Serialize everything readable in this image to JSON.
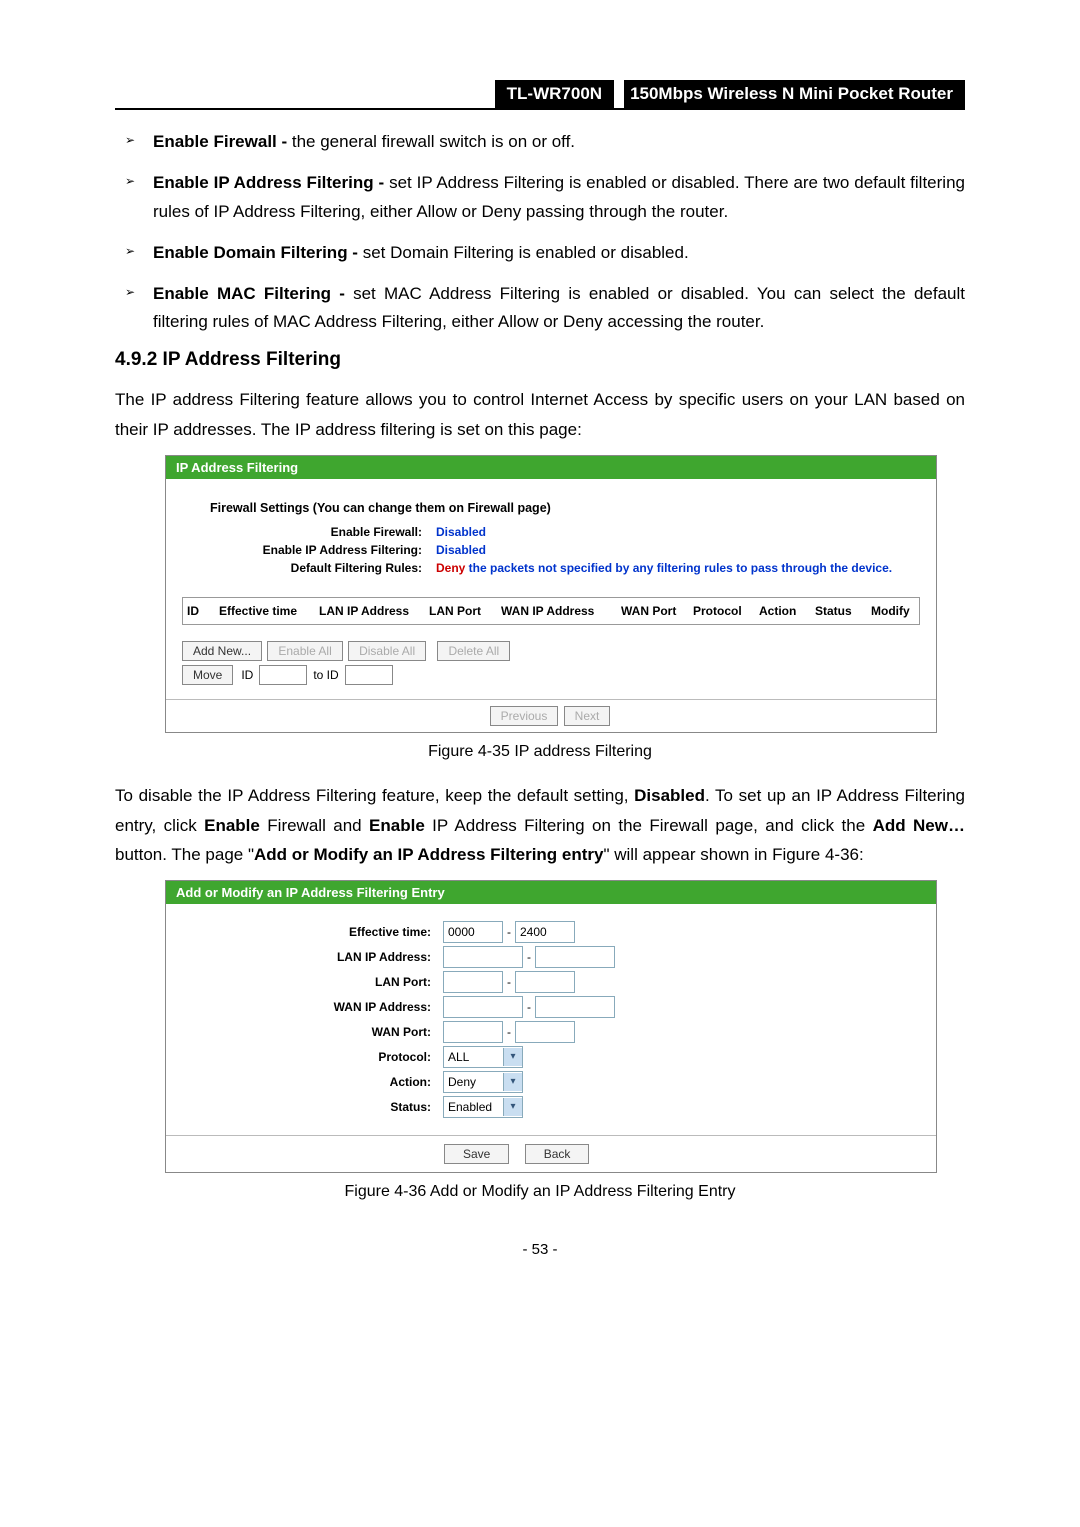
{
  "header": {
    "model": "TL-WR700N",
    "desc": "150Mbps Wireless N Mini Pocket Router"
  },
  "bullets": [
    {
      "lead": "Enable Firewall - ",
      "rest": "the general firewall switch is on or off."
    },
    {
      "lead": "Enable IP Address Filtering - ",
      "rest": "set IP Address Filtering is enabled or disabled. There are two default filtering rules of IP Address Filtering, either Allow or Deny passing through the router."
    },
    {
      "lead": "Enable Domain Filtering - ",
      "rest": "set Domain Filtering is enabled or disabled."
    },
    {
      "lead": "Enable MAC Filtering - ",
      "rest": "set MAC Address Filtering is enabled or disabled. You can select the default filtering rules of MAC Address Filtering, either Allow or Deny accessing the router."
    }
  ],
  "section_heading": "4.9.2  IP Address Filtering",
  "para1": "The IP address Filtering feature allows you to control Internet Access by specific users on your LAN based on their IP addresses. The IP address filtering is set on this page:",
  "fig1": {
    "title": "IP Address Filtering",
    "subtitle": "Firewall Settings (You can change them on Firewall page)",
    "rows": [
      {
        "label": "Enable Firewall:",
        "value": "Disabled",
        "style": "blue"
      },
      {
        "label": "Enable IP Address Filtering:",
        "value": "Disabled",
        "style": "blue"
      },
      {
        "label": "Default Filtering Rules:",
        "value_prefix": "Deny",
        "value_rest": " the packets not specified by any filtering rules to pass through the device.",
        "style": "red"
      }
    ],
    "cols": [
      "ID",
      "Effective time",
      "LAN IP Address",
      "LAN Port",
      "WAN IP Address",
      "WAN Port",
      "Protocol",
      "Action",
      "Status",
      "Modify"
    ],
    "btns1": {
      "add": "Add New...",
      "enable": "Enable All",
      "disable": "Disable All",
      "delete": "Delete All"
    },
    "btns2": {
      "move": "Move",
      "id_lbl": "ID",
      "to_lbl": "to ID"
    },
    "nav": {
      "prev": "Previous",
      "next": "Next"
    }
  },
  "caption1": "Figure 4-35 IP address Filtering",
  "para2_parts": {
    "p1": "To disable the IP Address Filtering feature, keep the default setting, ",
    "b1": "Disabled",
    "p2": ". To set up an IP Address Filtering entry, click ",
    "b2": "Enable",
    "p3": " Firewall and ",
    "b3": "Enable",
    "p4": " IP Address Filtering on the Firewall page, and click the ",
    "b4": "Add New…",
    "p5": " button. The page \"",
    "b5": "Add or Modify an IP Address Filtering entry",
    "p6": "\" will appear shown in Figure 4-36:"
  },
  "fig2": {
    "title": "Add or Modify an IP Address Filtering Entry",
    "fields": {
      "effective": {
        "label": "Effective time:",
        "from": "0000",
        "to": "2400"
      },
      "lanip": {
        "label": "LAN IP Address:"
      },
      "lanport": {
        "label": "LAN Port:"
      },
      "wanip": {
        "label": "WAN IP Address:"
      },
      "wanport": {
        "label": "WAN Port:"
      },
      "protocol": {
        "label": "Protocol:",
        "value": "ALL"
      },
      "action": {
        "label": "Action:",
        "value": "Deny"
      },
      "status": {
        "label": "Status:",
        "value": "Enabled"
      }
    },
    "buttons": {
      "save": "Save",
      "back": "Back"
    }
  },
  "caption2": "Figure 4-36 Add or Modify an IP Address Filtering Entry",
  "page_num": "- 53 -"
}
